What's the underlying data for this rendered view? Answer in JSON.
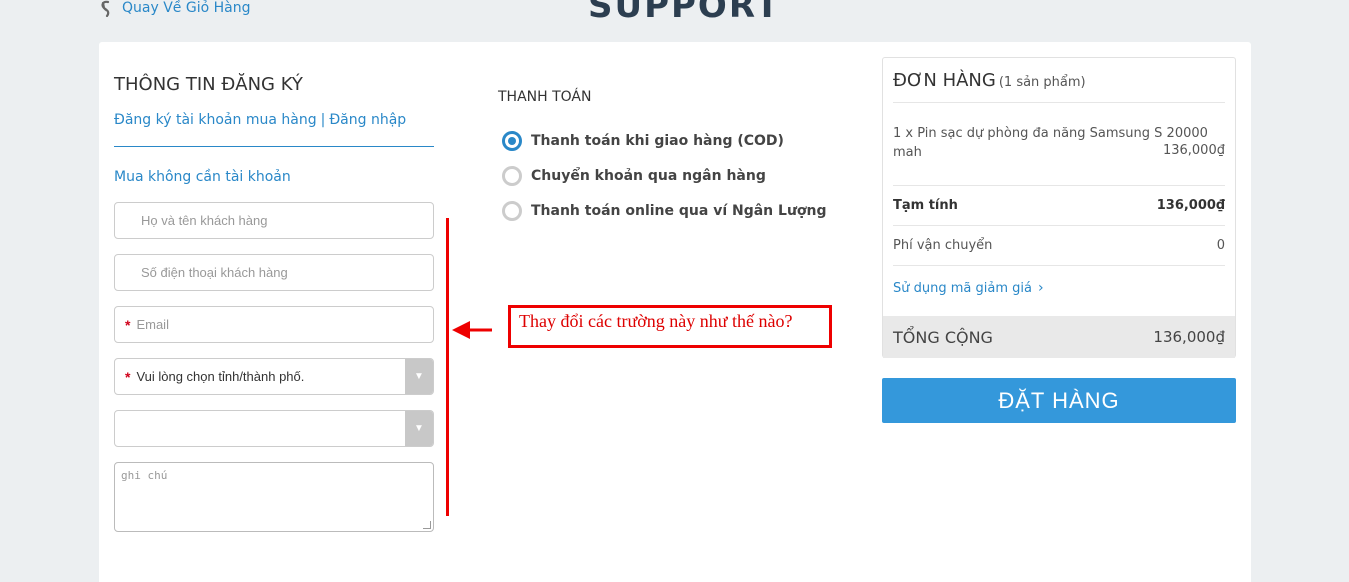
{
  "header": {
    "back_label": "Quay Về Giỏ Hàng",
    "page_title": "SUPPORT"
  },
  "registration": {
    "title": "THÔNG TIN ĐĂNG KÝ",
    "register_link": "Đăng ký tài khoản mua hàng",
    "separator": "|",
    "login_link": "Đăng nhập",
    "guest_label": "Mua không cần tài khoản",
    "fields": {
      "name_placeholder": "Họ và tên khách hàng",
      "phone_placeholder": "Số điện thoại khách hàng",
      "email_placeholder": "Email",
      "province_value": "Vui lòng chọn tỉnh/thành phố.",
      "district_value": "",
      "notes_placeholder": "ghi chú",
      "required_mark": "*"
    }
  },
  "annotation": {
    "text": "Thay đổi các trường này như thế nào?",
    "color": "#e00000"
  },
  "payment": {
    "title": "THANH TOÁN",
    "options": [
      {
        "label": "Thanh toán khi giao hàng (COD)",
        "selected": true
      },
      {
        "label": "Chuyển khoản qua ngân hàng",
        "selected": false
      },
      {
        "label": "Thanh toán online qua ví Ngân Lượng",
        "selected": false
      }
    ]
  },
  "order": {
    "title": "ĐƠN HÀNG",
    "count": "(1 sản phẩm)",
    "item_name": "1 x Pin sạc dự phòng đa năng Samsung S 20000 mah",
    "item_price": "136,000₫",
    "subtotal_label": "Tạm tính",
    "subtotal_value": "136,000₫",
    "shipping_label": "Phí vận chuyển",
    "shipping_value": "0",
    "coupon_label": "Sử dụng mã giảm giá",
    "total_label": "TỔNG CỘNG",
    "total_value": "136,000₫",
    "place_order_label": "ĐẶT HÀNG"
  },
  "colors": {
    "accent": "#2a88c8",
    "button": "#3498db",
    "background": "#eceff1"
  }
}
